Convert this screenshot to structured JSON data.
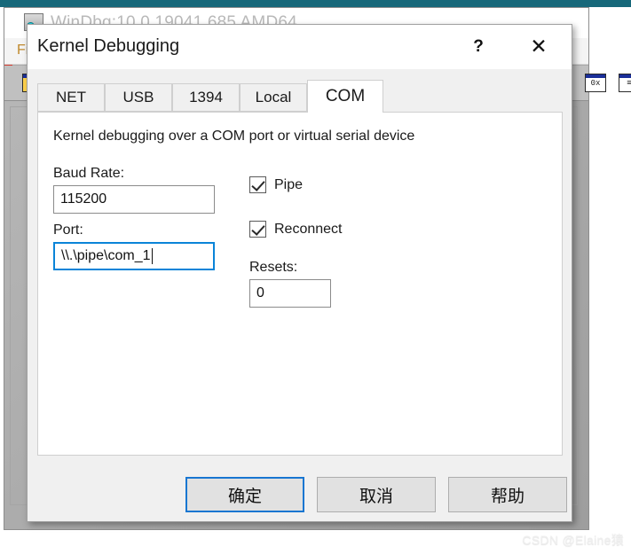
{
  "background_window": {
    "title": "WinDbg:10.0.19041.685 AMD64",
    "menu_item": "Fi",
    "toolbar_icons": [
      "hex-view-icon",
      "list-view-icon",
      "breakpoint-icon"
    ]
  },
  "dialog": {
    "title": "Kernel Debugging",
    "titlebar_buttons": {
      "help": "?",
      "close": "✕"
    },
    "tabs": [
      {
        "label": "NET",
        "selected": false
      },
      {
        "label": "USB",
        "selected": false
      },
      {
        "label": "1394",
        "selected": false
      },
      {
        "label": "Local",
        "selected": false
      },
      {
        "label": "COM",
        "selected": true
      }
    ],
    "panel": {
      "description": "Kernel debugging over a COM port or virtual serial device",
      "baud_rate_label": "Baud Rate:",
      "baud_rate_value": "115200",
      "port_label": "Port:",
      "port_value": "\\\\.\\pipe\\com_1",
      "pipe_label": "Pipe",
      "pipe_checked": true,
      "reconnect_label": "Reconnect",
      "reconnect_checked": true,
      "resets_label": "Resets:",
      "resets_value": "0"
    },
    "buttons": {
      "ok": "确定",
      "cancel": "取消",
      "help": "帮助"
    },
    "accent_color": "#1876d1",
    "focus_color": "#0a84d8"
  },
  "watermark": "CSDN @Elaine猿"
}
